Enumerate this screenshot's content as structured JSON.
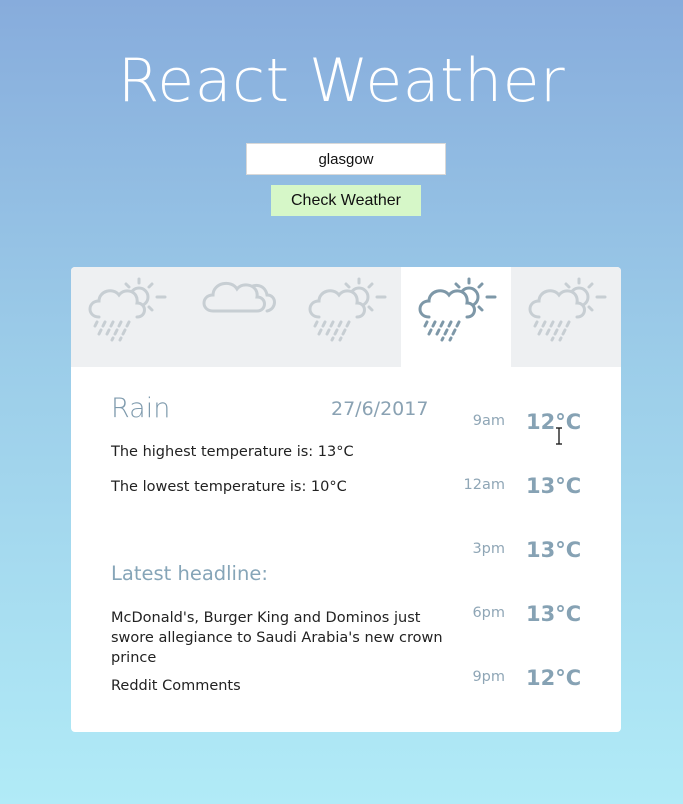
{
  "app": {
    "title": "React Weather"
  },
  "search": {
    "value": "glasgow",
    "button_label": "Check Weather"
  },
  "tabs": [
    {
      "icon": "rain-sun-icon",
      "active": false
    },
    {
      "icon": "cloud-icon",
      "active": false
    },
    {
      "icon": "rain-sun-icon",
      "active": false
    },
    {
      "icon": "rain-sun-icon",
      "active": true
    },
    {
      "icon": "rain-sun-icon",
      "active": false
    }
  ],
  "details": {
    "condition": "Rain",
    "date": "27/6/2017",
    "highest": "The highest temperature is: 13°C",
    "lowest": "The lowest temperature is: 10°C",
    "headline_label": "Latest headline:",
    "headline": "McDonald's, Burger King and Dominos just swore allegiance to Saudi Arabia's new crown prince",
    "comments_link": "Reddit Comments"
  },
  "hourly": [
    {
      "time": "9am",
      "temp": "12°C"
    },
    {
      "time": "12am",
      "temp": "13°C"
    },
    {
      "time": "3pm",
      "temp": "13°C"
    },
    {
      "time": "6pm",
      "temp": "13°C"
    },
    {
      "time": "9pm",
      "temp": "12°C"
    }
  ],
  "colors": {
    "icon_active": "#7e98a8",
    "icon_inactive": "#c7ced3",
    "accent_text": "#86a2b4"
  }
}
